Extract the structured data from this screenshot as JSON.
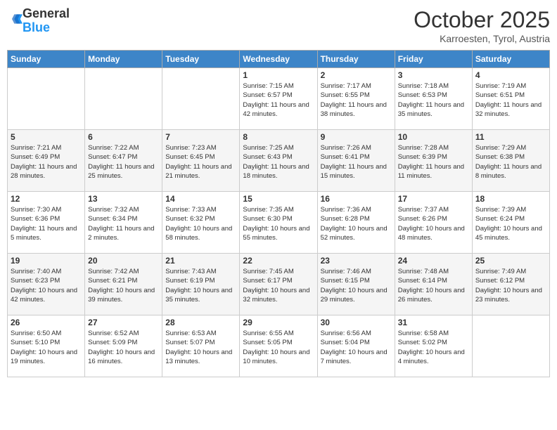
{
  "logo": {
    "general": "General",
    "blue": "Blue"
  },
  "title": "October 2025",
  "location": "Karroesten, Tyrol, Austria",
  "headers": [
    "Sunday",
    "Monday",
    "Tuesday",
    "Wednesday",
    "Thursday",
    "Friday",
    "Saturday"
  ],
  "weeks": [
    [
      {
        "day": "",
        "info": ""
      },
      {
        "day": "",
        "info": ""
      },
      {
        "day": "",
        "info": ""
      },
      {
        "day": "1",
        "info": "Sunrise: 7:15 AM\nSunset: 6:57 PM\nDaylight: 11 hours and 42 minutes."
      },
      {
        "day": "2",
        "info": "Sunrise: 7:17 AM\nSunset: 6:55 PM\nDaylight: 11 hours and 38 minutes."
      },
      {
        "day": "3",
        "info": "Sunrise: 7:18 AM\nSunset: 6:53 PM\nDaylight: 11 hours and 35 minutes."
      },
      {
        "day": "4",
        "info": "Sunrise: 7:19 AM\nSunset: 6:51 PM\nDaylight: 11 hours and 32 minutes."
      }
    ],
    [
      {
        "day": "5",
        "info": "Sunrise: 7:21 AM\nSunset: 6:49 PM\nDaylight: 11 hours and 28 minutes."
      },
      {
        "day": "6",
        "info": "Sunrise: 7:22 AM\nSunset: 6:47 PM\nDaylight: 11 hours and 25 minutes."
      },
      {
        "day": "7",
        "info": "Sunrise: 7:23 AM\nSunset: 6:45 PM\nDaylight: 11 hours and 21 minutes."
      },
      {
        "day": "8",
        "info": "Sunrise: 7:25 AM\nSunset: 6:43 PM\nDaylight: 11 hours and 18 minutes."
      },
      {
        "day": "9",
        "info": "Sunrise: 7:26 AM\nSunset: 6:41 PM\nDaylight: 11 hours and 15 minutes."
      },
      {
        "day": "10",
        "info": "Sunrise: 7:28 AM\nSunset: 6:39 PM\nDaylight: 11 hours and 11 minutes."
      },
      {
        "day": "11",
        "info": "Sunrise: 7:29 AM\nSunset: 6:38 PM\nDaylight: 11 hours and 8 minutes."
      }
    ],
    [
      {
        "day": "12",
        "info": "Sunrise: 7:30 AM\nSunset: 6:36 PM\nDaylight: 11 hours and 5 minutes."
      },
      {
        "day": "13",
        "info": "Sunrise: 7:32 AM\nSunset: 6:34 PM\nDaylight: 11 hours and 2 minutes."
      },
      {
        "day": "14",
        "info": "Sunrise: 7:33 AM\nSunset: 6:32 PM\nDaylight: 10 hours and 58 minutes."
      },
      {
        "day": "15",
        "info": "Sunrise: 7:35 AM\nSunset: 6:30 PM\nDaylight: 10 hours and 55 minutes."
      },
      {
        "day": "16",
        "info": "Sunrise: 7:36 AM\nSunset: 6:28 PM\nDaylight: 10 hours and 52 minutes."
      },
      {
        "day": "17",
        "info": "Sunrise: 7:37 AM\nSunset: 6:26 PM\nDaylight: 10 hours and 48 minutes."
      },
      {
        "day": "18",
        "info": "Sunrise: 7:39 AM\nSunset: 6:24 PM\nDaylight: 10 hours and 45 minutes."
      }
    ],
    [
      {
        "day": "19",
        "info": "Sunrise: 7:40 AM\nSunset: 6:23 PM\nDaylight: 10 hours and 42 minutes."
      },
      {
        "day": "20",
        "info": "Sunrise: 7:42 AM\nSunset: 6:21 PM\nDaylight: 10 hours and 39 minutes."
      },
      {
        "day": "21",
        "info": "Sunrise: 7:43 AM\nSunset: 6:19 PM\nDaylight: 10 hours and 35 minutes."
      },
      {
        "day": "22",
        "info": "Sunrise: 7:45 AM\nSunset: 6:17 PM\nDaylight: 10 hours and 32 minutes."
      },
      {
        "day": "23",
        "info": "Sunrise: 7:46 AM\nSunset: 6:15 PM\nDaylight: 10 hours and 29 minutes."
      },
      {
        "day": "24",
        "info": "Sunrise: 7:48 AM\nSunset: 6:14 PM\nDaylight: 10 hours and 26 minutes."
      },
      {
        "day": "25",
        "info": "Sunrise: 7:49 AM\nSunset: 6:12 PM\nDaylight: 10 hours and 23 minutes."
      }
    ],
    [
      {
        "day": "26",
        "info": "Sunrise: 6:50 AM\nSunset: 5:10 PM\nDaylight: 10 hours and 19 minutes."
      },
      {
        "day": "27",
        "info": "Sunrise: 6:52 AM\nSunset: 5:09 PM\nDaylight: 10 hours and 16 minutes."
      },
      {
        "day": "28",
        "info": "Sunrise: 6:53 AM\nSunset: 5:07 PM\nDaylight: 10 hours and 13 minutes."
      },
      {
        "day": "29",
        "info": "Sunrise: 6:55 AM\nSunset: 5:05 PM\nDaylight: 10 hours and 10 minutes."
      },
      {
        "day": "30",
        "info": "Sunrise: 6:56 AM\nSunset: 5:04 PM\nDaylight: 10 hours and 7 minutes."
      },
      {
        "day": "31",
        "info": "Sunrise: 6:58 AM\nSunset: 5:02 PM\nDaylight: 10 hours and 4 minutes."
      },
      {
        "day": "",
        "info": ""
      }
    ]
  ]
}
